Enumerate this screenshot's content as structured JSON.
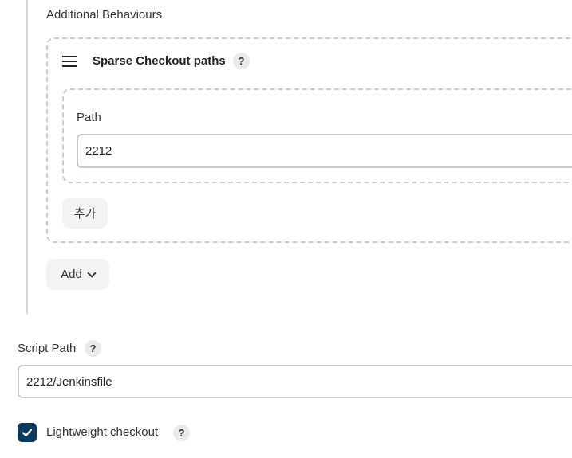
{
  "additional_behaviours": {
    "label": "Additional Behaviours",
    "sparse_checkout": {
      "title": "Sparse Checkout paths",
      "help": "?",
      "path_label": "Path",
      "path_value": "2212",
      "add_path_label": "추가"
    },
    "add_label": "Add",
    "add_icon": "chevron-down-icon"
  },
  "script_path": {
    "label": "Script Path",
    "help": "?",
    "value": "2212/Jenkinsfile"
  },
  "lightweight_checkout": {
    "label": "Lightweight checkout",
    "checked": true,
    "help": "?"
  },
  "colors": {
    "checkbox_fill": "#0b3b5c",
    "border": "#c4c9ce",
    "dashed_border": "#c8cbcf"
  }
}
